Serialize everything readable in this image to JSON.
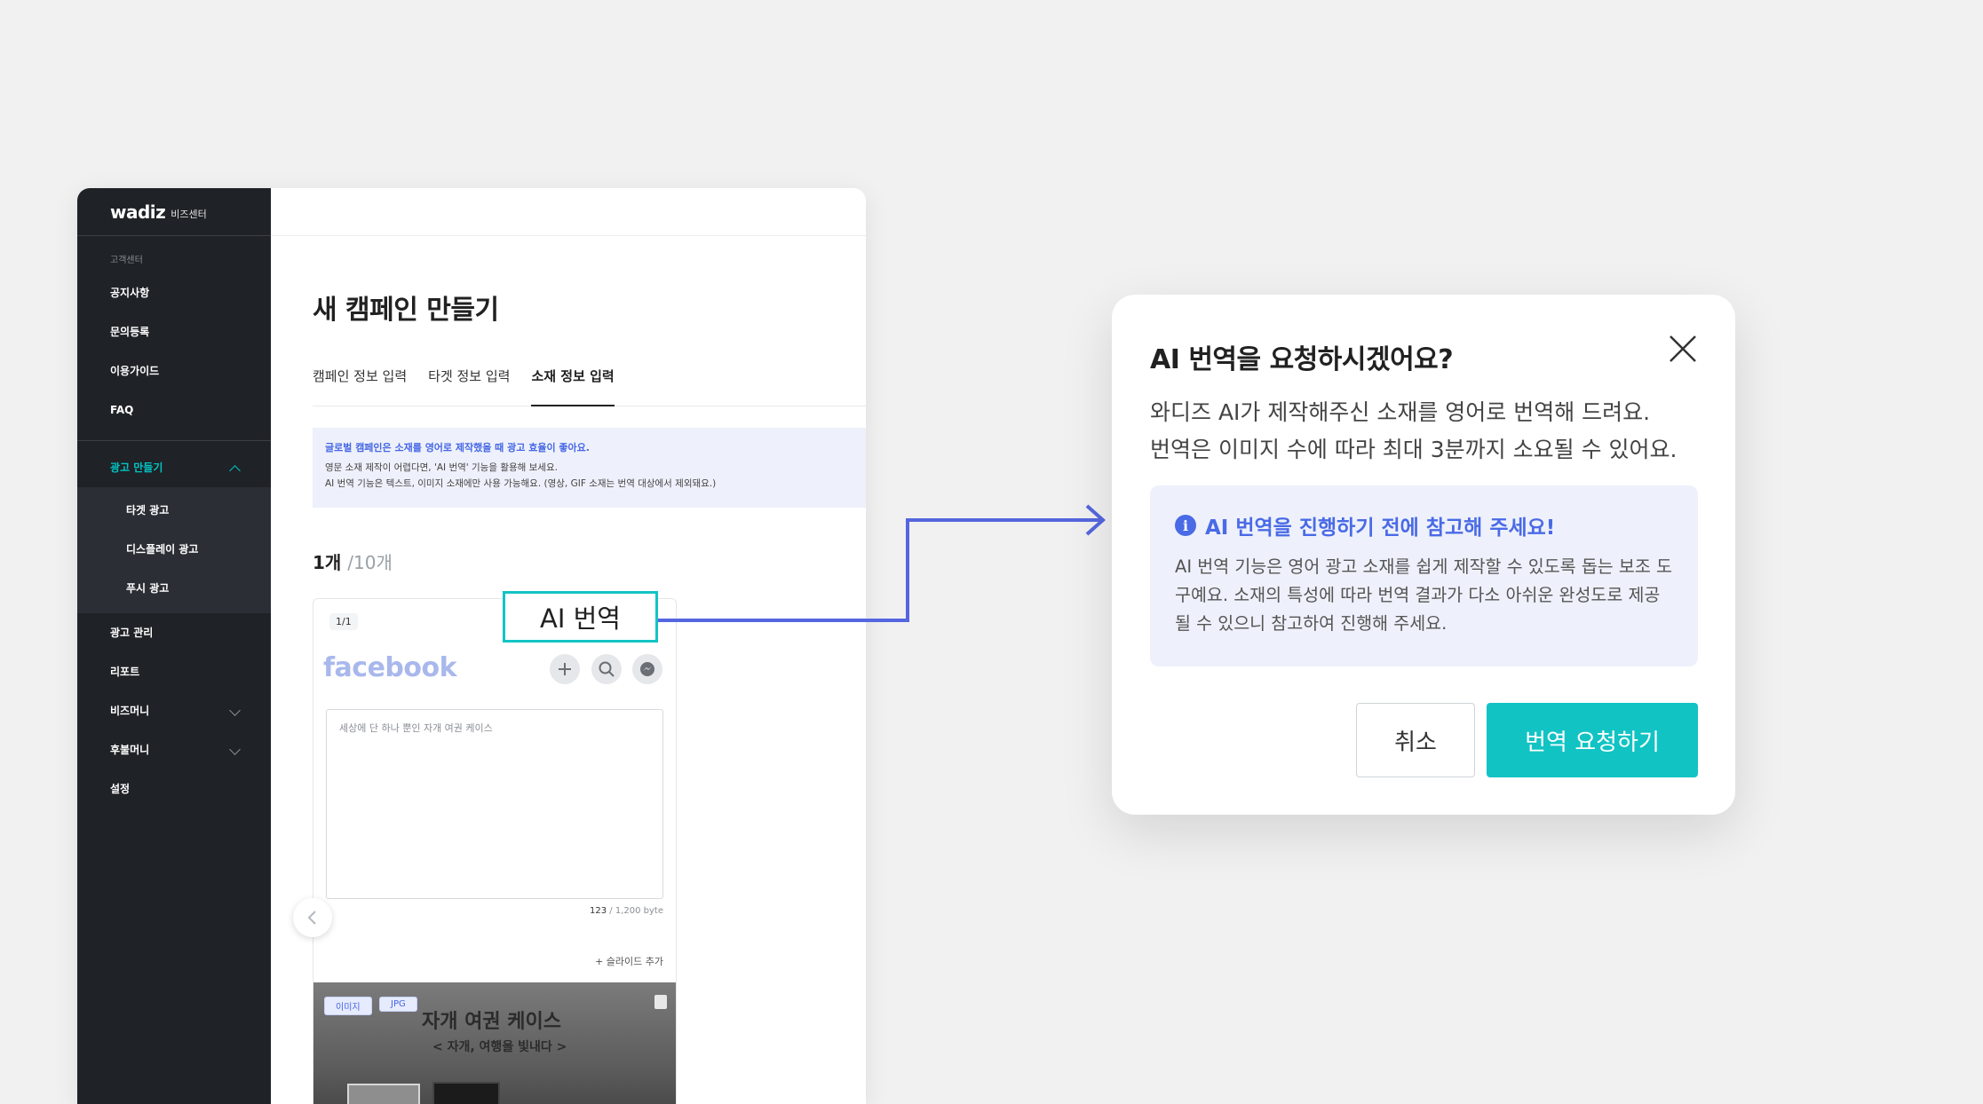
{
  "sidebar": {
    "logo": "wadiz",
    "logo_sub": "비즈센터",
    "caption": "고객센터",
    "support_items": [
      {
        "label": "공지사항"
      },
      {
        "label": "문의등록"
      },
      {
        "label": "이용가이드"
      },
      {
        "label": "FAQ"
      }
    ],
    "create_ad": {
      "label": "광고 만들기"
    },
    "create_ad_sub": [
      {
        "label": "타겟 광고"
      },
      {
        "label": "디스플레이 광고"
      },
      {
        "label": "푸시 광고"
      }
    ],
    "bottom_items": [
      {
        "label": "광고 관리"
      },
      {
        "label": "리포트"
      },
      {
        "label": "비즈머니"
      },
      {
        "label": "후불머니"
      },
      {
        "label": "설정"
      }
    ]
  },
  "main": {
    "title": "새 캠페인 만들기",
    "tabs": [
      {
        "label": "캠페인 정보 입력"
      },
      {
        "label": "타겟 정보 입력"
      },
      {
        "label": "소재 정보 입력"
      }
    ],
    "notice": {
      "highlight": "글로벌 캠페인은 소재를 영어로 제작했을 때 광고 효율이 좋아요.",
      "line1": "영문 소재 제작이 어렵다면, 'AI 번역' 기능을 활용해 보세요.",
      "line2": "AI 번역 기능은 텍스트, 이미지 소재에만 사용 가능해요. (영상, GIF 소재는 번역 대상에서 제외돼요.)"
    },
    "count": "1개",
    "count_total": "/10개",
    "card": {
      "page_indicator": "1/1",
      "platform": "facebook",
      "text_placeholder": "세상에 단 하나 뿐인 자개 여권 케이스",
      "byte_count": "123",
      "byte_limit": " / 1,200 byte",
      "slide_add": "슬라이드 추가",
      "tag_image": "이미지",
      "tag_jpg": "JPG",
      "thumb_title": "자개 여권 케이스",
      "thumb_sub": "< 자개, 여행을 빛내다 >"
    }
  },
  "callout": {
    "label": "AI 번역"
  },
  "dialog": {
    "title": "AI 번역을 요청하시겠어요?",
    "desc_line1": "와디즈 AI가 제작해주신 소재를 영어로 번역해 드려요.",
    "desc_line2": "번역은 이미지 수에 따라 최대 3분까지 소요될 수 있어요.",
    "info_title": "AI 번역을 진행하기 전에 참고해 주세요!",
    "info_body": "AI 번역 기능은 영어 광고 소재를 쉽게 제작할 수 있도록 돕는 보조 도구예요. 소재의 특성에 따라 번역 결과가 다소 아쉬운 완성도로 제공될 수 있으니 참고하여 진행해 주세요.",
    "cancel_label": "취소",
    "confirm_label": "번역 요청하기"
  },
  "colors": {
    "accent": "#12c3c4",
    "info_blue": "#4a6ae6",
    "sidebar_bg": "#1f2226",
    "connector": "#5566e0"
  }
}
